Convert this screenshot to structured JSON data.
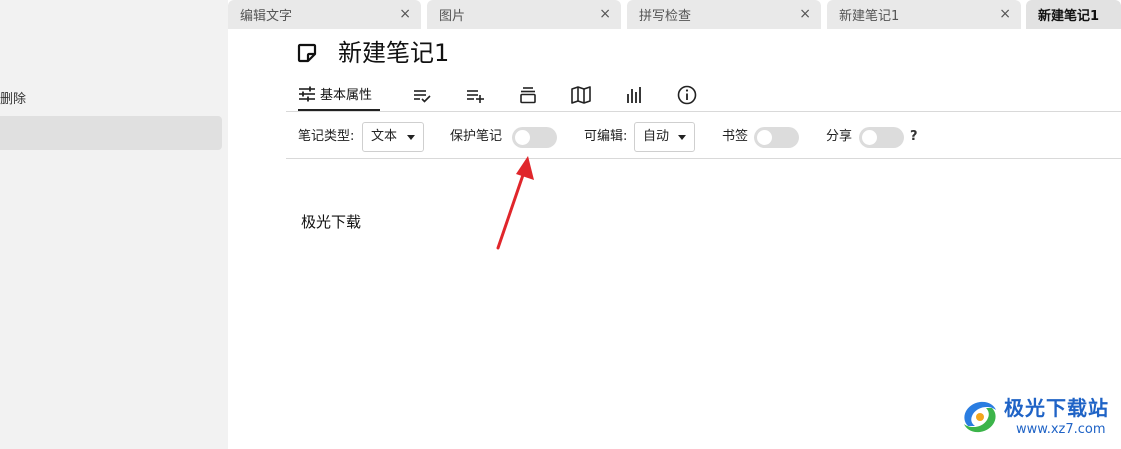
{
  "sidebar": {
    "delete_label": "删除"
  },
  "tabs": [
    {
      "label": "编辑文字",
      "close": "×"
    },
    {
      "label": "图片",
      "close": "×"
    },
    {
      "label": "拼写检查",
      "close": "×"
    },
    {
      "label": "新建笔记1",
      "close": "×"
    },
    {
      "label": "新建笔记1",
      "close": ""
    }
  ],
  "note": {
    "title": "新建笔记1",
    "icon": "note-edit-icon",
    "content": "极光下载"
  },
  "prop_tabs": {
    "basic_label": "基本属性",
    "icons": [
      "sliders-icon",
      "list-check-icon",
      "list-add-icon",
      "layers-icon",
      "map-icon",
      "bar-chart-icon",
      "info-icon"
    ]
  },
  "properties": {
    "note_type_label": "笔记类型:",
    "note_type_value": "文本",
    "protect_label": "保护笔记",
    "editable_label": "可编辑:",
    "editable_value": "自动",
    "bookmark_label": "书签",
    "share_label": "分享",
    "help": "?"
  },
  "watermark": {
    "title": "极光下载站",
    "url": "www.xz7.com"
  },
  "colors": {
    "annotation_arrow": "#e0262b",
    "watermark_blue": "#1f63c6"
  }
}
